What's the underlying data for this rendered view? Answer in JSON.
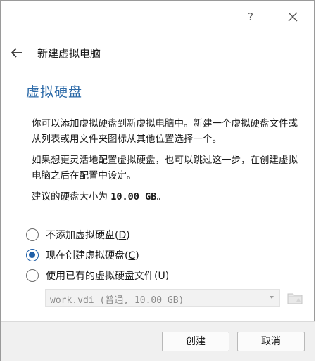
{
  "titlebar": {
    "help_label": "?",
    "close_icon": "close-icon"
  },
  "nav": {
    "back_icon": "arrow-left-icon",
    "title": "新建虚拟电脑"
  },
  "page": {
    "heading": "虚拟硬盘",
    "paragraph1": "你可以添加虚拟硬盘到新虚拟电脑中。新建一个虚拟硬盘文件或从列表或用文件夹图标从其他位置选择一个。",
    "paragraph2": "如果想更灵活地配置虚拟硬盘，也可以跳过这一步，在创建虚拟电脑之后在配置中设定。",
    "size_prefix": "建议的硬盘大小为 ",
    "size_value": "10.00 GB",
    "size_suffix": "。"
  },
  "options": [
    {
      "label": "不添加虚拟硬盘(",
      "key": "D",
      "tail": ")",
      "selected": false
    },
    {
      "label": "现在创建虚拟硬盘(",
      "key": "C",
      "tail": ")",
      "selected": true
    },
    {
      "label": "使用已有的虚拟硬盘文件(",
      "key": "U",
      "tail": ")",
      "selected": false
    }
  ],
  "file_select": {
    "value": "work.vdi (普通, 10.00 GB)",
    "disabled": true,
    "folder_icon": "folder-icon"
  },
  "buttons": {
    "create": "创建",
    "cancel": "取消"
  },
  "colors": {
    "heading": "#2c6aa8",
    "radio_selected": "#1f5fa8"
  }
}
